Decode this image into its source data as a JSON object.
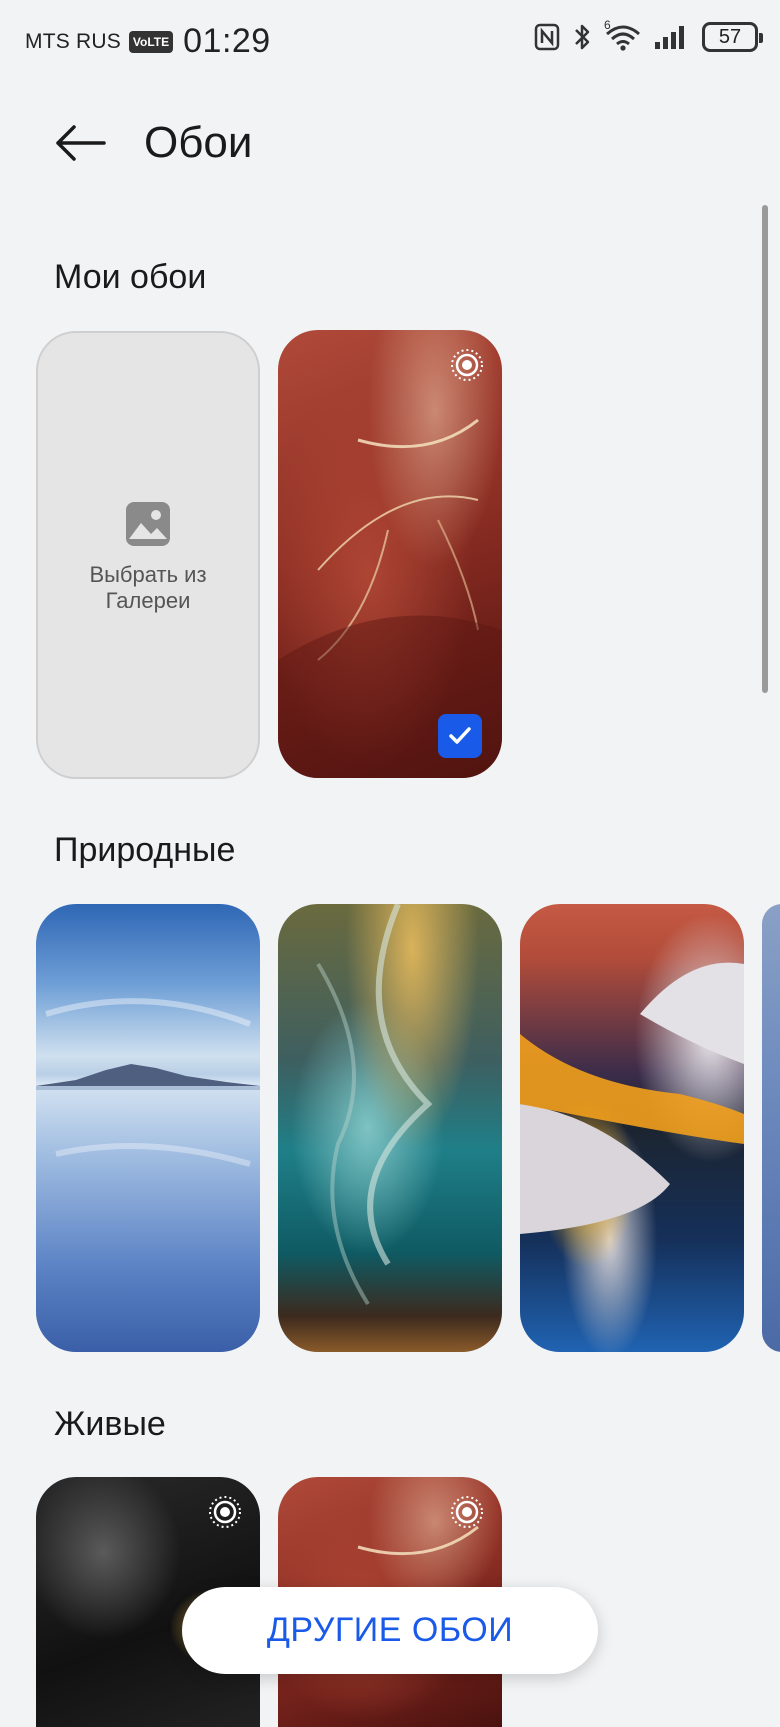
{
  "status_bar": {
    "carrier": "MTS RUS",
    "volte": "VoLTE",
    "time": "01:29",
    "wifi_label": "6",
    "battery": "57",
    "icons": [
      "nfc-icon",
      "bluetooth-icon",
      "wifi-icon",
      "signal-icon",
      "battery-icon"
    ]
  },
  "header": {
    "title": "Обои",
    "back_icon": "arrow-left-icon"
  },
  "sections": {
    "my": {
      "title": "Мои обои",
      "gallery_label_line1": "Выбрать из",
      "gallery_label_line2": "Галереи"
    },
    "nature": {
      "title": "Природные"
    },
    "live": {
      "title": "Живые"
    }
  },
  "more_button": {
    "label": "ДРУГИЕ ОБОИ"
  },
  "colors": {
    "accent": "#1a5ae8",
    "background": "#f1f3f5"
  }
}
